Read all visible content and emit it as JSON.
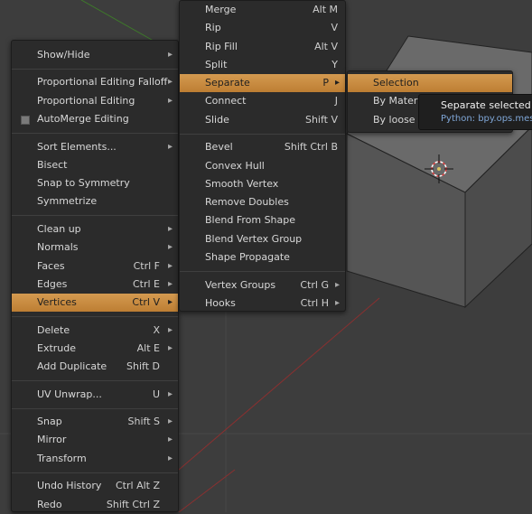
{
  "main_menu": {
    "items": [
      {
        "label": "Show/Hide",
        "shortcut": "",
        "arrow": true
      },
      {
        "sep": true
      },
      {
        "label": "Proportional Editing Falloff",
        "shortcut": "",
        "arrow": true
      },
      {
        "label": "Proportional Editing",
        "shortcut": "",
        "arrow": true
      },
      {
        "label": "AutoMerge Editing",
        "shortcut": "",
        "arrow": false,
        "checkbox": true
      },
      {
        "sep": true
      },
      {
        "label": "Sort Elements...",
        "shortcut": "",
        "arrow": true
      },
      {
        "label": "Bisect",
        "shortcut": "",
        "arrow": false
      },
      {
        "label": "Snap to Symmetry",
        "shortcut": "",
        "arrow": false
      },
      {
        "label": "Symmetrize",
        "shortcut": "",
        "arrow": false
      },
      {
        "sep": true
      },
      {
        "label": "Clean up",
        "shortcut": "",
        "arrow": true
      },
      {
        "label": "Normals",
        "shortcut": "",
        "arrow": true
      },
      {
        "label": "Faces",
        "shortcut": "Ctrl F",
        "arrow": true
      },
      {
        "label": "Edges",
        "shortcut": "Ctrl E",
        "arrow": true
      },
      {
        "label": "Vertices",
        "shortcut": "Ctrl V",
        "arrow": true,
        "highlight": true
      },
      {
        "sep": true
      },
      {
        "label": "Delete",
        "shortcut": "X",
        "arrow": true
      },
      {
        "label": "Extrude",
        "shortcut": "Alt E",
        "arrow": true
      },
      {
        "label": "Add Duplicate",
        "shortcut": "Shift D",
        "arrow": false
      },
      {
        "sep": true
      },
      {
        "label": "UV Unwrap...",
        "shortcut": "U",
        "arrow": true
      },
      {
        "sep": true
      },
      {
        "label": "Snap",
        "shortcut": "Shift S",
        "arrow": true
      },
      {
        "label": "Mirror",
        "shortcut": "",
        "arrow": true
      },
      {
        "label": "Transform",
        "shortcut": "",
        "arrow": true
      },
      {
        "sep": true
      },
      {
        "label": "Undo History",
        "shortcut": "Ctrl Alt Z",
        "arrow": false
      },
      {
        "label": "Redo",
        "shortcut": "Shift Ctrl Z",
        "arrow": false
      }
    ]
  },
  "vertices_menu": {
    "items": [
      {
        "label": "Merge",
        "shortcut": "Alt M",
        "arrow": false
      },
      {
        "label": "Rip",
        "shortcut": "V",
        "arrow": false
      },
      {
        "label": "Rip Fill",
        "shortcut": "Alt V",
        "arrow": false
      },
      {
        "label": "Split",
        "shortcut": "Y",
        "arrow": false
      },
      {
        "label": "Separate",
        "shortcut": "P",
        "arrow": true,
        "highlight": true
      },
      {
        "label": "Connect",
        "shortcut": "J",
        "arrow": false
      },
      {
        "label": "Slide",
        "shortcut": "Shift V",
        "arrow": false
      },
      {
        "sep": true
      },
      {
        "label": "Bevel",
        "shortcut": "Shift Ctrl B",
        "arrow": false
      },
      {
        "label": "Convex Hull",
        "shortcut": "",
        "arrow": false
      },
      {
        "label": "Smooth Vertex",
        "shortcut": "",
        "arrow": false
      },
      {
        "label": "Remove Doubles",
        "shortcut": "",
        "arrow": false
      },
      {
        "label": "Blend From Shape",
        "shortcut": "",
        "arrow": false
      },
      {
        "label": "Blend Vertex Group",
        "shortcut": "",
        "arrow": false
      },
      {
        "label": "Shape Propagate",
        "shortcut": "",
        "arrow": false
      },
      {
        "sep": true
      },
      {
        "label": "Vertex Groups",
        "shortcut": "Ctrl G",
        "arrow": true
      },
      {
        "label": "Hooks",
        "shortcut": "Ctrl H",
        "arrow": true
      }
    ]
  },
  "separate_menu": {
    "items": [
      {
        "label": "Selection",
        "highlight": true
      },
      {
        "label": "By Material"
      },
      {
        "label": "By loose p"
      }
    ]
  },
  "tooltip": {
    "line1": "Separate selected ge",
    "line2": "Python: bpy.ops.mesh.s"
  },
  "colors": {
    "highlight": "#c98a3e",
    "menu_bg": "#2b2b2b",
    "viewport_bg": "#3d3d3d",
    "python_text": "#7fa6d6"
  },
  "icons": {
    "arrow": "submenu-arrow-icon",
    "cursor": "3d-cursor-icon"
  }
}
